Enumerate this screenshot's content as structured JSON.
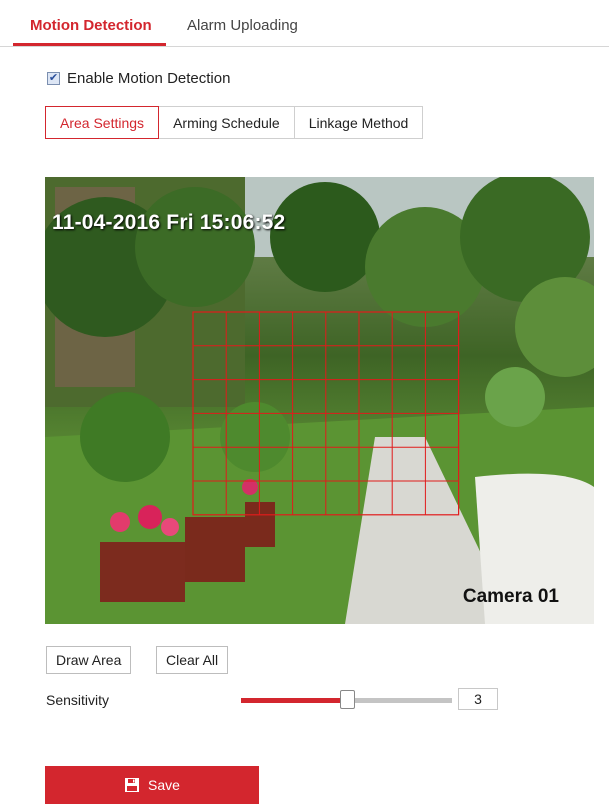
{
  "tabs": {
    "motion_detection": "Motion Detection",
    "alarm_uploading": "Alarm Uploading"
  },
  "enable": {
    "label": "Enable Motion Detection",
    "checked": true
  },
  "subtabs": {
    "area_settings": "Area Settings",
    "arming_schedule": "Arming Schedule",
    "linkage_method": "Linkage Method"
  },
  "camera": {
    "timestamp": "11-04-2016 Fri 15:06:52",
    "name": "Camera 01"
  },
  "buttons": {
    "draw_area": "Draw Area",
    "clear_all": "Clear All",
    "save": "Save"
  },
  "sensitivity": {
    "label": "Sensitivity",
    "value": "3",
    "fraction": 0.5
  },
  "colors": {
    "accent": "#d3262e",
    "grid": "#e11b1b"
  },
  "icons": {
    "save": "floppy-disk-icon",
    "checkbox": "checkmark-icon"
  }
}
